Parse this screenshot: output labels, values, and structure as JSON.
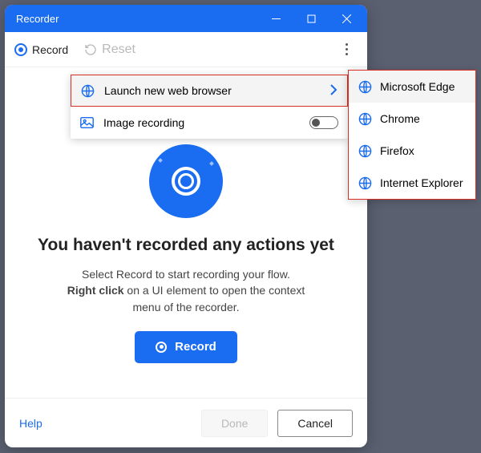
{
  "window": {
    "title": "Recorder"
  },
  "toolbar": {
    "record_label": "Record",
    "reset_label": "Reset"
  },
  "dropdown": {
    "launch_label": "Launch new web browser",
    "image_label": "Image recording"
  },
  "browsers": {
    "edge": "Microsoft Edge",
    "chrome": "Chrome",
    "firefox": "Firefox",
    "ie": "Internet Explorer"
  },
  "empty": {
    "heading": "You haven't recorded any actions yet",
    "line1": "Select Record to start recording your flow.",
    "bold": "Right click",
    "line2_rest": " on a UI element to open the context",
    "line3": "menu of the recorder.",
    "record_button": "Record"
  },
  "footer": {
    "help": "Help",
    "done": "Done",
    "cancel": "Cancel"
  }
}
